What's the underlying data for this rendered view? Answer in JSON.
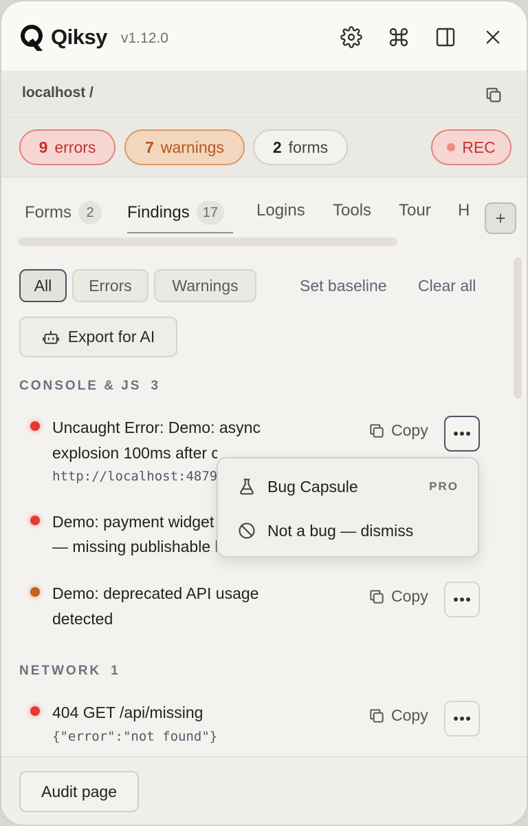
{
  "header": {
    "brand": "Qiksy",
    "version": "v1.12.0",
    "icons": [
      "settings-gear-icon",
      "command-icon",
      "panel-layout-icon",
      "close-icon"
    ]
  },
  "url": {
    "text": "localhost /"
  },
  "status": {
    "errors_count": "9",
    "errors_label": "errors",
    "warnings_count": "7",
    "warnings_label": "warnings",
    "forms_count": "2",
    "forms_label": "forms",
    "rec_label": "REC"
  },
  "tabs": [
    {
      "label": "Forms",
      "count": "2"
    },
    {
      "label": "Findings",
      "count": "17"
    },
    {
      "label": "Logins"
    },
    {
      "label": "Tools"
    },
    {
      "label": "Tour"
    },
    {
      "label": "H"
    }
  ],
  "tab_add": "+",
  "filters": {
    "all": "All",
    "errors": "Errors",
    "warnings": "Warnings",
    "set_baseline": "Set baseline",
    "clear_all": "Clear all",
    "export": "Export for AI"
  },
  "sections": {
    "console": {
      "title": "CONSOLE & JS",
      "count": "3"
    },
    "network": {
      "title": "NETWORK",
      "count": "1"
    }
  },
  "findings": [
    {
      "line1": "Uncaught Error: Demo: async",
      "line2": "explosion 100ms after click",
      "sub": "http://localhost:4879/:1",
      "severity": "error"
    },
    {
      "line1": "Demo: payment widget",
      "line2": "— missing publishable key",
      "severity": "error"
    },
    {
      "line1": "Demo: deprecated API usage",
      "line2": "detected",
      "severity": "warning"
    },
    {
      "line1": "404 GET /api/missing",
      "sub": "{\"error\":\"not found\"}",
      "severity": "error"
    }
  ],
  "actions": {
    "copy": "Copy"
  },
  "menu": {
    "bug_capsule": "Bug Capsule",
    "pro": "PRO",
    "dismiss": "Not a bug — dismiss"
  },
  "footer": {
    "audit": "Audit page"
  },
  "colors": {
    "error": "#e53935",
    "warning": "#c2621b",
    "background": "#f4f2ee"
  }
}
